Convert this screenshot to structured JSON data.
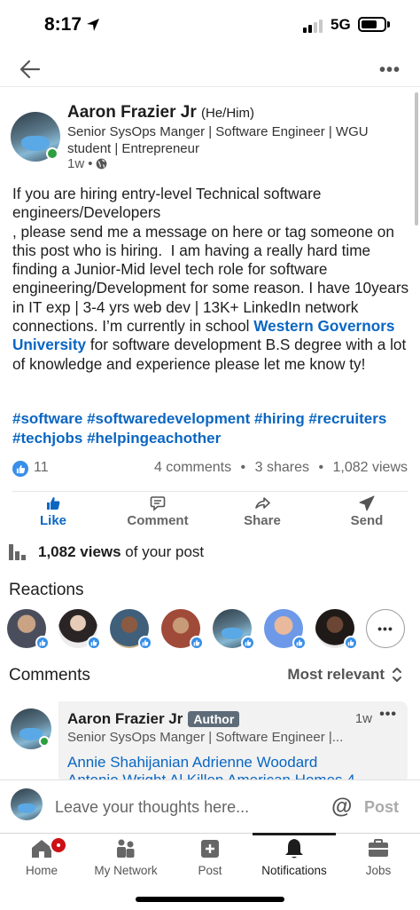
{
  "status_bar": {
    "time": "8:17",
    "network": "5G",
    "battery_level": 0.7,
    "signal_bars": 2
  },
  "top_nav": {
    "back_icon": "arrow-left-icon",
    "more_icon": "more-horizontal-icon"
  },
  "post": {
    "author": "Aaron Frazier Jr",
    "pronouns": "(He/Him)",
    "headline": "Senior SysOps Manger | Software Engineer | WGU student | Entrepreneur",
    "time": "1w",
    "separator": "•",
    "body_before_link": "If you are hiring entry-level Technical software engineers/Developers\n, please send me a message on here or tag someone on this post who is hiring.  I am having a really hard time finding a Junior-Mid level tech role for software engineering/Development for some reason. I have 10years in IT exp | 3-4 yrs web dev | 13K+ LinkedIn network connections. I’m currently in school ",
    "body_link": "Western Governors University",
    "body_after_link": " for software development B.S degree with a lot of knowledge and experience please let me know ty!",
    "hashtags": "#software #softwaredevelopment #hiring #recruiters  #techjobs #helpingeachother"
  },
  "stats": {
    "reactions": "11",
    "comments": "4 comments",
    "shares": "3 shares",
    "views": "1,082 views",
    "dot": "•"
  },
  "actions": [
    {
      "label": "Like",
      "icon": "thumbs-up-icon",
      "active": true
    },
    {
      "label": "Comment",
      "icon": "comment-icon",
      "active": false
    },
    {
      "label": "Share",
      "icon": "share-icon",
      "active": false
    },
    {
      "label": "Send",
      "icon": "send-icon",
      "active": false
    }
  ],
  "views_summary": {
    "count": "1,082 views",
    "suffix": " of your post"
  },
  "reactions_section": {
    "title": "Reactions",
    "more_label": "•••"
  },
  "comments_section": {
    "title": "Comments",
    "sort_label": "Most relevant",
    "comment": {
      "author": "Aaron Frazier Jr",
      "badge": "Author",
      "time": "1w",
      "more": "•••",
      "headline": "Senior SysOps Manger | Software Engineer |...",
      "mentions_line1": "Annie Shahijanian Adrienne Woodard",
      "mentions_line2": "Antonio Wright Al Killen American Homes 4"
    }
  },
  "composer": {
    "placeholder": "Leave your thoughts here...",
    "at_symbol": "@",
    "post_label": "Post"
  },
  "tab_bar": [
    {
      "label": "Home",
      "icon": "home-icon",
      "badge": true
    },
    {
      "label": "My Network",
      "icon": "network-icon"
    },
    {
      "label": "Post",
      "icon": "plus-square-icon"
    },
    {
      "label": "Notifications",
      "icon": "bell-icon",
      "active": true
    },
    {
      "label": "Jobs",
      "icon": "briefcase-icon"
    }
  ],
  "colors": {
    "accent": "#0a66c2",
    "like_blue": "#378fe9",
    "online": "#2e9e3f",
    "badge_red": "#cc1016"
  }
}
